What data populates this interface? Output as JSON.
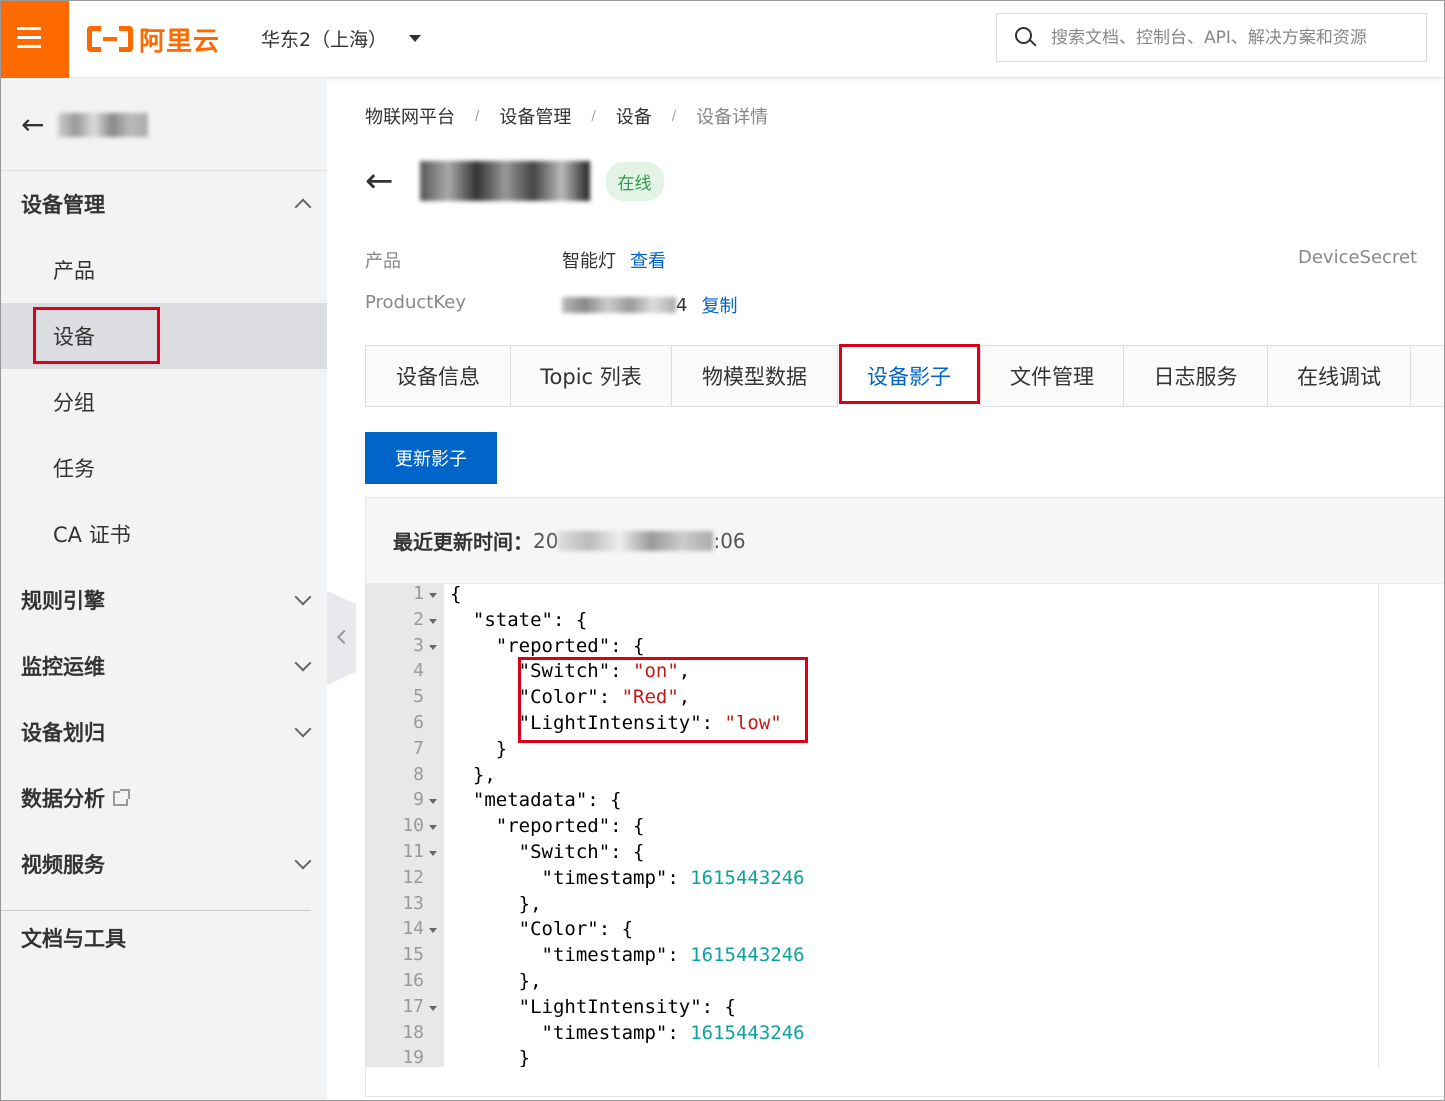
{
  "header": {
    "logo_text": "阿里云",
    "region": "华东2（上海）",
    "search_placeholder": "搜索文档、控制台、API、解决方案和资源",
    "brand_color": "#ff6a00"
  },
  "sidebar": {
    "groups": [
      {
        "label": "设备管理",
        "expanded": true,
        "items": [
          "产品",
          "设备",
          "分组",
          "任务",
          "CA 证书"
        ],
        "active_item": "设备"
      },
      {
        "label": "规则引擎",
        "expanded": false
      },
      {
        "label": "监控运维",
        "expanded": false
      },
      {
        "label": "设备划归",
        "expanded": false
      },
      {
        "label": "数据分析",
        "external": true
      },
      {
        "label": "视频服务",
        "expanded": false
      }
    ],
    "footer": "文档与工具"
  },
  "breadcrumb": [
    "物联网平台",
    "设备管理",
    "设备",
    "设备详情"
  ],
  "device": {
    "status": "在线",
    "product_label": "产品",
    "product_value": "智能灯",
    "product_link": "查看",
    "productkey_label": "ProductKey",
    "productkey_suffix": "4",
    "productkey_link": "复制",
    "secret_label": "DeviceSecret"
  },
  "tabs": [
    "设备信息",
    "Topic 列表",
    "物模型数据",
    "设备影子",
    "文件管理",
    "日志服务",
    "在线调试"
  ],
  "active_tab": "设备影子",
  "update_button": "更新影子",
  "shadow": {
    "updated_label": "最近更新时间：",
    "updated_prefix": "20",
    "updated_suffix": ":06",
    "line_numbers": [
      "1",
      "2",
      "3",
      "4",
      "5",
      "6",
      "7",
      "8",
      "9",
      "10",
      "11",
      "12",
      "13",
      "14",
      "15",
      "16",
      "17",
      "18",
      "19"
    ],
    "code": [
      {
        "t": [
          [
            "k",
            "{"
          ]
        ]
      },
      {
        "t": [
          [
            "k",
            "  \"state\": {"
          ]
        ]
      },
      {
        "t": [
          [
            "k",
            "    \"reported\": {"
          ]
        ]
      },
      {
        "t": [
          [
            "k",
            "      \"Switch\": "
          ],
          [
            "s",
            "\"on\""
          ],
          [
            "k",
            ","
          ]
        ]
      },
      {
        "t": [
          [
            "k",
            "      \"Color\": "
          ],
          [
            "s",
            "\"Red\""
          ],
          [
            "k",
            ","
          ]
        ]
      },
      {
        "t": [
          [
            "k",
            "      \"LightIntensity\": "
          ],
          [
            "s",
            "\"low\""
          ]
        ]
      },
      {
        "t": [
          [
            "k",
            "    }"
          ]
        ]
      },
      {
        "t": [
          [
            "k",
            "  },"
          ]
        ]
      },
      {
        "t": [
          [
            "k",
            "  \"metadata\": {"
          ]
        ]
      },
      {
        "t": [
          [
            "k",
            "    \"reported\": {"
          ]
        ]
      },
      {
        "t": [
          [
            "k",
            "      \"Switch\": {"
          ]
        ]
      },
      {
        "t": [
          [
            "k",
            "        \"timestamp\": "
          ],
          [
            "n",
            "1615443246"
          ]
        ]
      },
      {
        "t": [
          [
            "k",
            "      },"
          ]
        ]
      },
      {
        "t": [
          [
            "k",
            "      \"Color\": {"
          ]
        ]
      },
      {
        "t": [
          [
            "k",
            "        \"timestamp\": "
          ],
          [
            "n",
            "1615443246"
          ]
        ]
      },
      {
        "t": [
          [
            "k",
            "      },"
          ]
        ]
      },
      {
        "t": [
          [
            "k",
            "      \"LightIntensity\": {"
          ]
        ]
      },
      {
        "t": [
          [
            "k",
            "        \"timestamp\": "
          ],
          [
            "n",
            "1615443246"
          ]
        ]
      },
      {
        "t": [
          [
            "k",
            "      }"
          ]
        ]
      }
    ],
    "fold_lines": [
      1,
      2,
      3,
      9,
      10,
      11,
      14,
      17
    ]
  }
}
